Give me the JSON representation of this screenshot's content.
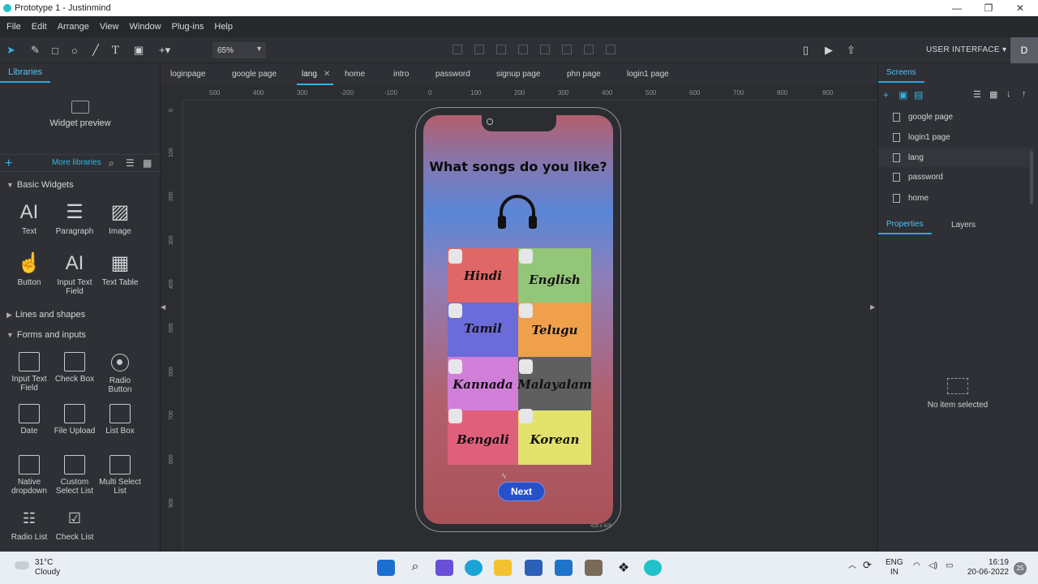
{
  "window": {
    "title": "Prototype 1 - Justinmind",
    "min": "—",
    "max": "❐",
    "close": "✕"
  },
  "menu": [
    "File",
    "Edit",
    "Arrange",
    "View",
    "Window",
    "Plug-ins",
    "Help"
  ],
  "toolbar": {
    "zoom": "65%",
    "mode": "USER INTERFACE",
    "avatar": "D"
  },
  "left": {
    "tab": "Libraries",
    "widget_preview": "Widget preview",
    "more_libraries": "More libraries",
    "sections": {
      "basic": "Basic Widgets",
      "lines": "Lines and shapes",
      "forms": "Forms and inputs"
    },
    "basic_widgets": [
      {
        "label": "Text",
        "glyph": "AI"
      },
      {
        "label": "Paragraph",
        "glyph": "☰"
      },
      {
        "label": "Image",
        "glyph": "▨"
      },
      {
        "label": "Button",
        "glyph": "☝"
      },
      {
        "label": "Input Text Field",
        "glyph": "AI"
      },
      {
        "label": "Text Table",
        "glyph": "▦"
      }
    ],
    "form_widgets": [
      {
        "label": "Input Text Field"
      },
      {
        "label": "Check Box"
      },
      {
        "label": "Radio Button"
      },
      {
        "label": "Date"
      },
      {
        "label": "File Upload"
      },
      {
        "label": "List Box"
      },
      {
        "label": "Native dropdown"
      },
      {
        "label": "Custom Select List"
      },
      {
        "label": "Multi Select List"
      },
      {
        "label": "Radio List"
      },
      {
        "label": "Check List"
      }
    ]
  },
  "tabs": [
    "loginpage",
    "google page",
    "lang",
    "home",
    "intro",
    "password",
    "signup page",
    "phn page",
    "login1 page"
  ],
  "ruler_h": [
    "500",
    "400",
    "300",
    "-200",
    "-100",
    "0",
    "100",
    "200",
    "300",
    "400",
    "500",
    "600",
    "700",
    "800",
    "900"
  ],
  "ruler_v": [
    "0",
    "100",
    "200",
    "300",
    "400",
    "500",
    "600",
    "700",
    "800",
    "900"
  ],
  "phone": {
    "question": "What songs do you like?",
    "languages": [
      {
        "name": "Hindi",
        "color": "#e06767"
      },
      {
        "name": "English",
        "color": "#94c679"
      },
      {
        "name": "Tamil",
        "color": "#6b6bd9"
      },
      {
        "name": "Telugu",
        "color": "#f0a04b"
      },
      {
        "name": "Kannada",
        "color": "#d07fd9"
      },
      {
        "name": "Malayalam",
        "color": "#5f5f5f"
      },
      {
        "name": "Bengali",
        "color": "#e0607c"
      },
      {
        "name": "Korean",
        "color": "#e2e26c"
      }
    ],
    "next": "Next",
    "size_label": "428 x 926"
  },
  "right": {
    "tab": "Screens",
    "screens": [
      "google page",
      "login1 page",
      "lang",
      "password",
      "home"
    ],
    "properties": "Properties",
    "layers": "Layers",
    "no_item": "No item selected"
  },
  "taskbar": {
    "temp": "31°C",
    "condition": "Cloudy",
    "lang1": "ENG",
    "lang2": "IN",
    "time": "16:19",
    "date": "20-06-2022",
    "badge": "25"
  }
}
